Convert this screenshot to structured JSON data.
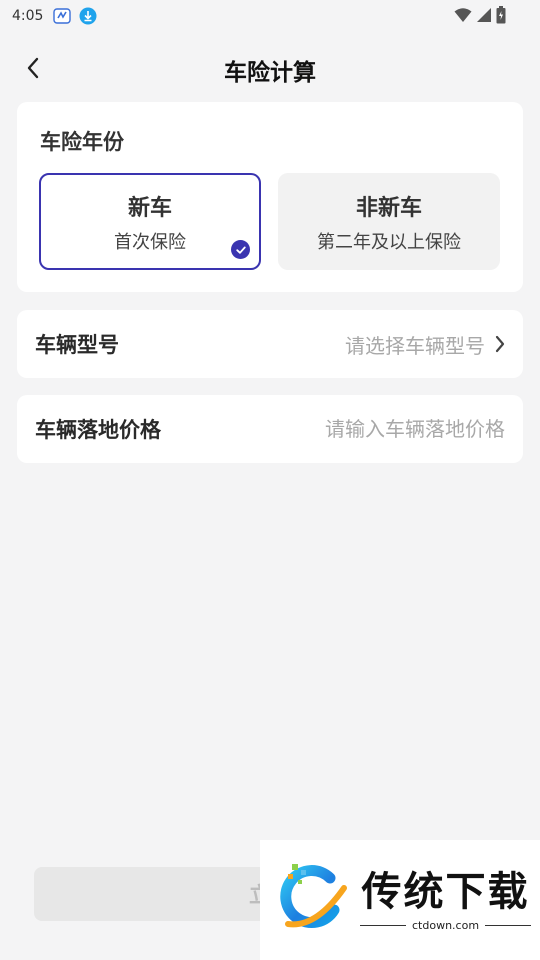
{
  "status_bar": {
    "time": "4:05",
    "icons": [
      "app-badge-icon",
      "download-icon",
      "wifi-icon",
      "signal-icon",
      "battery-icon"
    ]
  },
  "nav": {
    "title": "车险计算",
    "back_icon": "chevron-left-icon"
  },
  "insurance_year": {
    "label": "车险年份",
    "options": [
      {
        "title": "新车",
        "subtitle": "首次保险",
        "selected": true
      },
      {
        "title": "非新车",
        "subtitle": "第二年及以上保险",
        "selected": false
      }
    ]
  },
  "vehicle_model": {
    "label": "车辆型号",
    "placeholder": "请选择车辆型号"
  },
  "vehicle_price": {
    "label": "车辆落地价格",
    "placeholder": "请输入车辆落地价格"
  },
  "submit": {
    "label": "立即"
  },
  "watermark": {
    "title": "传统下载",
    "url": "ctdown.com"
  },
  "colors": {
    "accent": "#3a34b0",
    "background": "#f4f4f5",
    "placeholder": "#a8a8a8"
  }
}
